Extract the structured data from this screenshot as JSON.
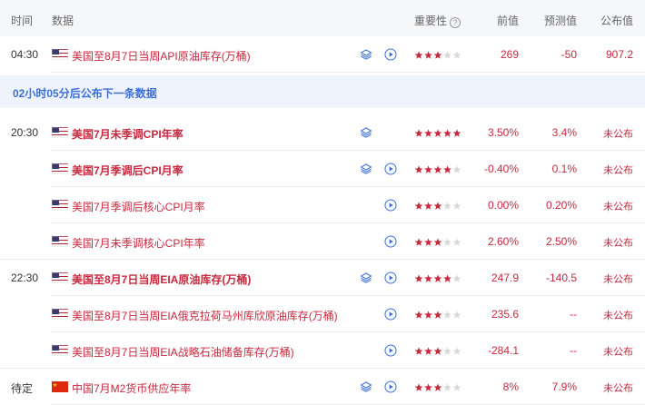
{
  "header": {
    "time": "时间",
    "data": "数据",
    "importance": "重要性",
    "prev": "前值",
    "forecast": "预测值",
    "published": "公布值"
  },
  "banner": "02小时05分后公布下一条数据",
  "rows": [
    {
      "time": "04:30",
      "flag": "us",
      "title": "美国至8月7日当周API原油库存(万桶)",
      "bold": false,
      "layer_icon": true,
      "play_icon": true,
      "stars": 3,
      "prev": "269",
      "forecast": "-50",
      "published": "907.2"
    },
    {
      "time": "20:30",
      "flag": "us",
      "title": "美国7月未季调CPI年率",
      "bold": true,
      "layer_icon": true,
      "play_icon": false,
      "stars": 5,
      "prev": "3.50%",
      "forecast": "3.4%",
      "published": "未公布"
    },
    {
      "time": "",
      "flag": "us",
      "title": "美国7月季调后CPI月率",
      "bold": true,
      "layer_icon": true,
      "play_icon": true,
      "stars": 4,
      "prev": "-0.40%",
      "forecast": "0.1%",
      "published": "未公布"
    },
    {
      "time": "",
      "flag": "us",
      "title": "美国7月季调后核心CPI月率",
      "bold": false,
      "layer_icon": false,
      "play_icon": true,
      "stars": 3,
      "prev": "0.00%",
      "forecast": "0.20%",
      "published": "未公布"
    },
    {
      "time": "",
      "flag": "us",
      "title": "美国7月未季调核心CPI年率",
      "bold": false,
      "layer_icon": false,
      "play_icon": true,
      "stars": 3,
      "prev": "2.60%",
      "forecast": "2.50%",
      "published": "未公布"
    },
    {
      "time": "22:30",
      "flag": "us",
      "title": "美国至8月7日当周EIA原油库存(万桶)",
      "bold": true,
      "layer_icon": true,
      "play_icon": true,
      "stars": 4,
      "prev": "247.9",
      "forecast": "-140.5",
      "published": "未公布"
    },
    {
      "time": "",
      "flag": "us",
      "title": "美国至8月7日当周EIA俄克拉荷马州库欣原油库存(万桶)",
      "bold": false,
      "layer_icon": false,
      "play_icon": true,
      "stars": 3,
      "prev": "235.6",
      "forecast": "--",
      "published": "未公布"
    },
    {
      "time": "",
      "flag": "us",
      "title": "美国至8月7日当周EIA战略石油储备库存(万桶)",
      "bold": false,
      "layer_icon": false,
      "play_icon": true,
      "stars": 3,
      "prev": "-284.1",
      "forecast": "--",
      "published": "未公布"
    },
    {
      "time": "待定",
      "flag": "cn",
      "title": "中国7月M2货币供应年率",
      "bold": false,
      "layer_icon": true,
      "play_icon": true,
      "stars": 3,
      "prev": "8%",
      "forecast": "7.9%",
      "published": "未公布"
    }
  ],
  "colors": {
    "accent_red": "#c7293f",
    "banner_blue": "#3d6fd6",
    "star_on": "#c7293f",
    "star_off": "#d9d9d9",
    "icon_blue": "#3d6fd6"
  }
}
